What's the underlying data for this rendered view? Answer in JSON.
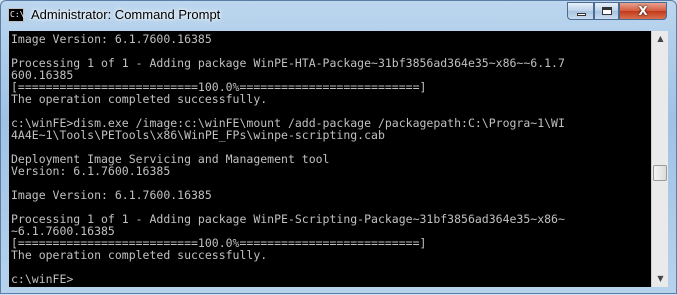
{
  "window": {
    "title": "Administrator: Command Prompt",
    "icon": "cmd-icon",
    "icon_text": "C:\\",
    "controls": {
      "minimize": "minimize-icon",
      "maximize": "maximize-icon",
      "close_label": "X"
    }
  },
  "console": {
    "lines": [
      "Image Version: 6.1.7600.16385",
      "",
      "Processing 1 of 1 - Adding package WinPE-HTA-Package~31bf3856ad364e35~x86~~6.1.7",
      "600.16385",
      "[==========================100.0%==========================]",
      "The operation completed successfully.",
      "",
      "c:\\winFE>dism.exe /image:c:\\winFE\\mount /add-package /packagepath:C:\\Progra~1\\WI",
      "4A4E~1\\Tools\\PETools\\x86\\WinPE_FPs\\winpe-scripting.cab",
      "",
      "Deployment Image Servicing and Management tool",
      "Version: 6.1.7600.16385",
      "",
      "Image Version: 6.1.7600.16385",
      "",
      "Processing 1 of 1 - Adding package WinPE-Scripting-Package~31bf3856ad364e35~x86~",
      "~6.1.7600.16385",
      "[==========================100.0%==========================]",
      "The operation completed successfully.",
      "",
      "c:\\winFE>"
    ]
  },
  "scrollbar": {
    "up": "▲",
    "down": "▼"
  }
}
